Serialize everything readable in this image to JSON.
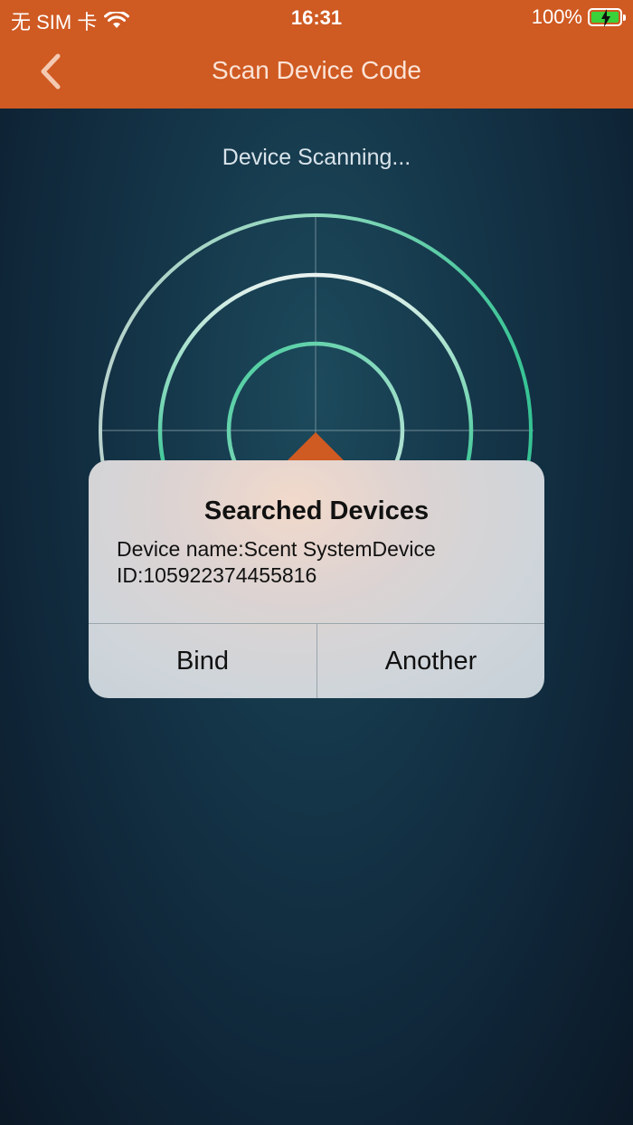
{
  "status_bar": {
    "carrier": "无 SIM 卡",
    "time": "16:31",
    "battery": "100%"
  },
  "nav": {
    "title": "Scan Device Code",
    "back_icon": "chevron-left-icon"
  },
  "scan": {
    "status_text": "Device Scanning..."
  },
  "dialog": {
    "title": "Searched Devices",
    "device_name_line": "Device name:Scent SystemDevice",
    "device_id_line": "ID:105922374455816",
    "bind_label": "Bind",
    "another_label": "Another"
  },
  "colors": {
    "header": "#cf5a22",
    "radar_ring": "#3ec89b",
    "battery_fill": "#3ad13a"
  }
}
